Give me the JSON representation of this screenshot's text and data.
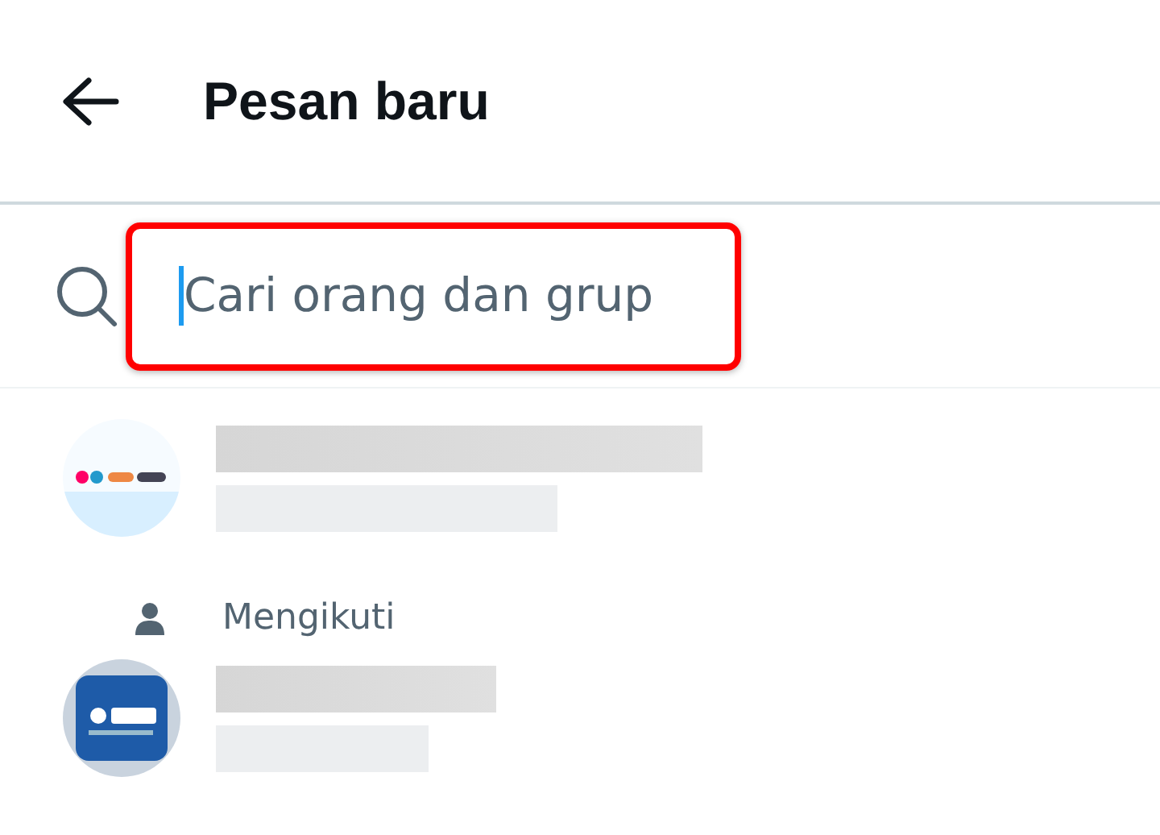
{
  "header": {
    "title": "Pesan baru"
  },
  "search": {
    "placeholder": "Cari orang dan grup",
    "focused": true,
    "highlighted": true
  },
  "contacts": [
    {
      "redacted": true
    },
    {
      "label": "Mengikuti",
      "redacted": true
    }
  ]
}
